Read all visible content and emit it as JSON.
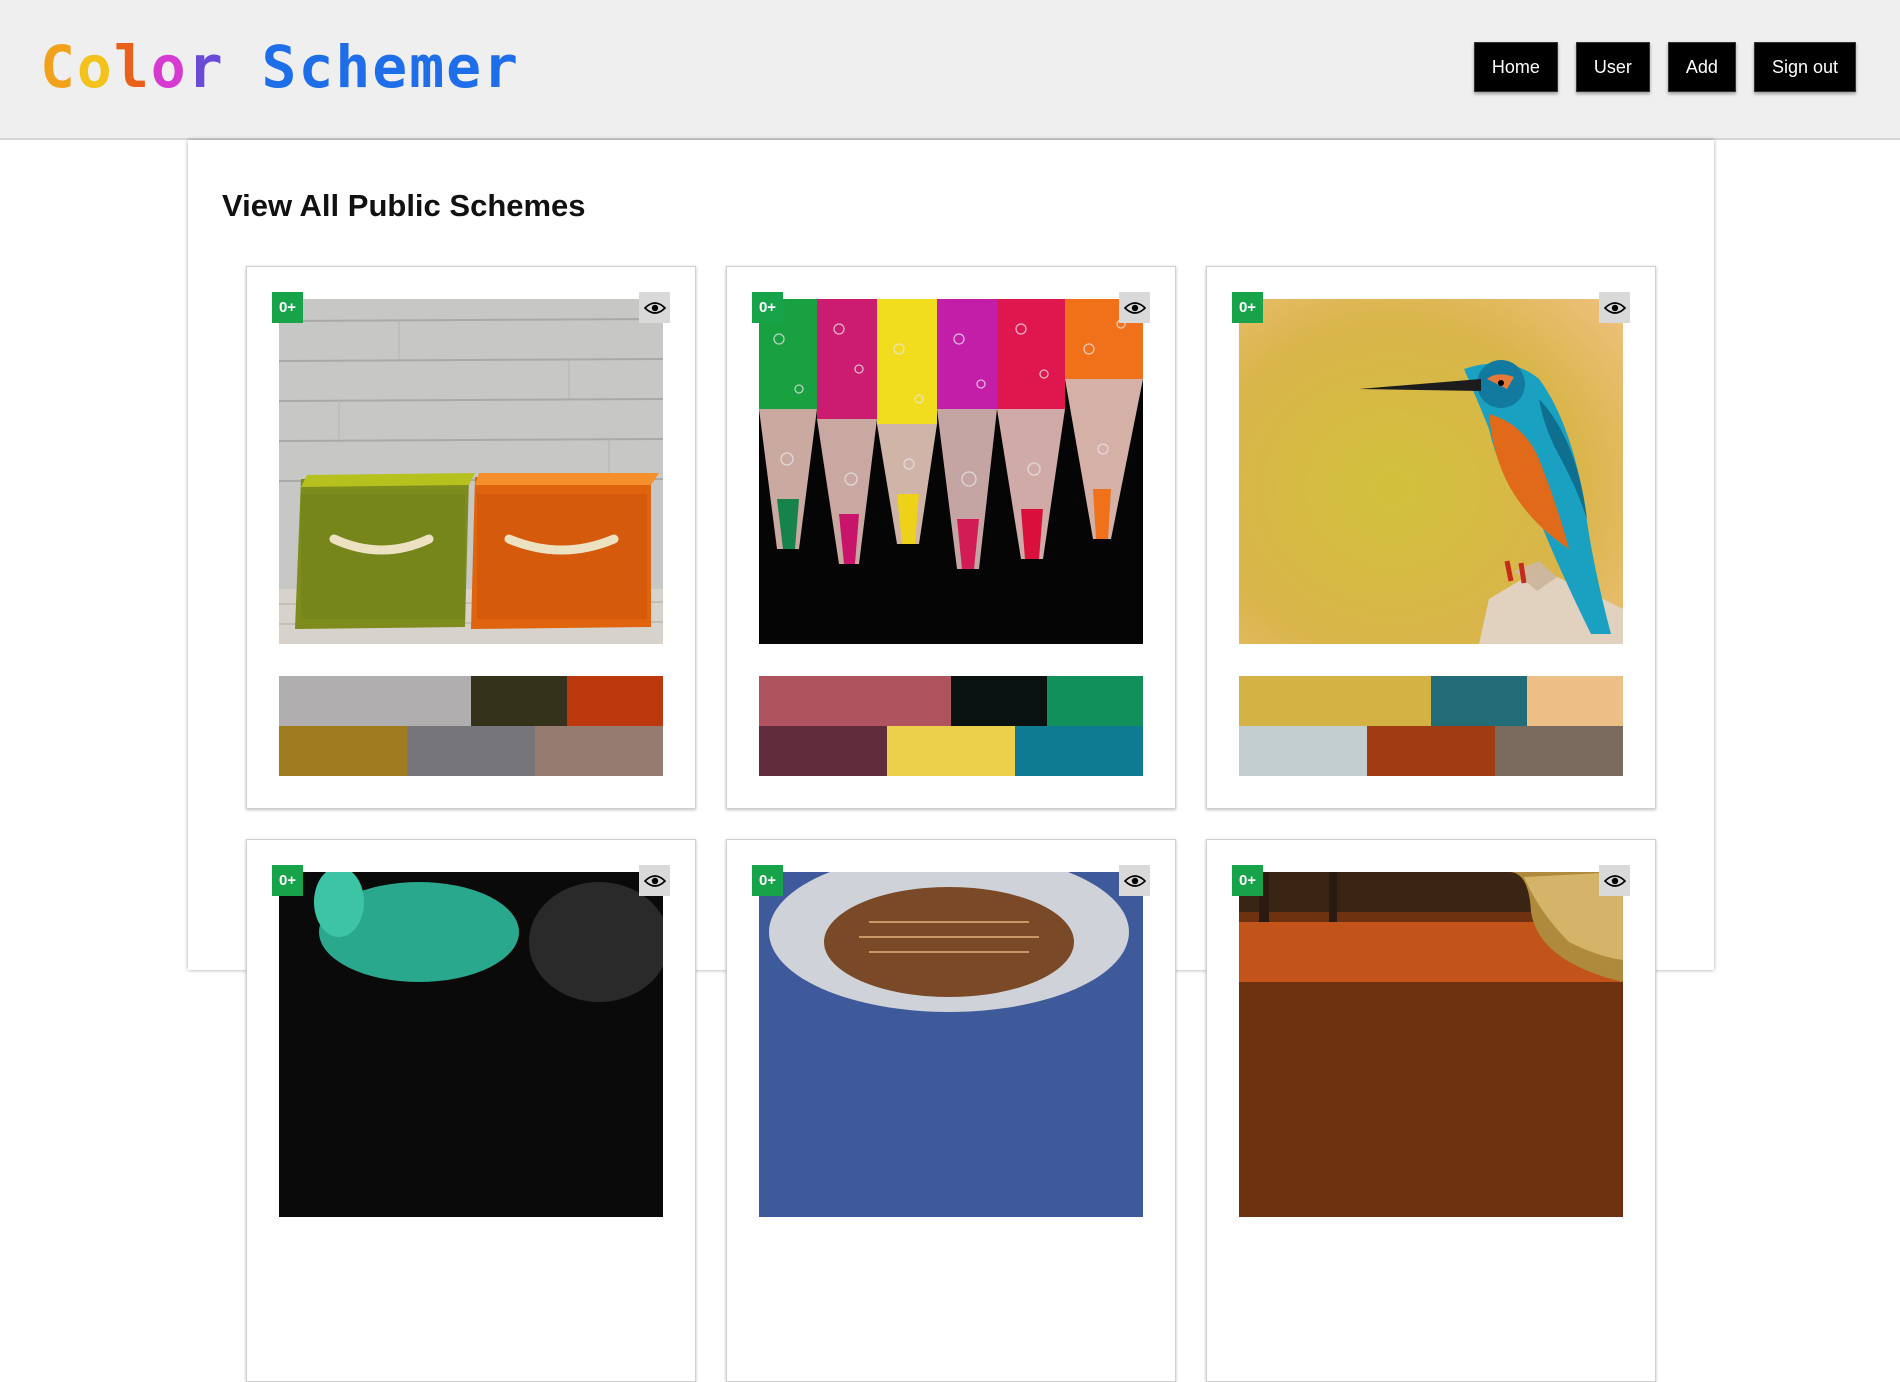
{
  "header": {
    "logo_parts": [
      "C",
      "o",
      "l",
      "o",
      "r"
    ],
    "logo_rest": "Schemer",
    "nav": [
      "Home",
      "User",
      "Add",
      "Sign out"
    ]
  },
  "main": {
    "title": "View All Public Schemes",
    "cards": [
      {
        "badge": "0+",
        "image": "colored-baskets-photo",
        "palette": [
          [
            "#b0aeae",
            "#34321a",
            "#be380d"
          ],
          [
            "#a17c1f",
            "#76767a",
            "#957b70"
          ]
        ]
      },
      {
        "badge": "0+",
        "image": "colored-pencils-photo",
        "palette": [
          [
            "#af545e",
            "#091211",
            "#12905c"
          ],
          [
            "#612d3d",
            "#ecd04c",
            "#0f7b92"
          ]
        ]
      },
      {
        "badge": "0+",
        "image": "kingfisher-bird-photo",
        "palette": [
          [
            "#d4b243",
            "#226c78",
            "#ebbf86"
          ],
          [
            "#c3cfcf",
            "#a13b11",
            "#7b6a5e"
          ]
        ]
      },
      {
        "badge": "0+",
        "image": "green-creature-photo",
        "palette": []
      },
      {
        "badge": "0+",
        "image": "mushroom-photo",
        "palette": []
      },
      {
        "badge": "0+",
        "image": "autumn-forest-photo",
        "palette": []
      }
    ]
  }
}
